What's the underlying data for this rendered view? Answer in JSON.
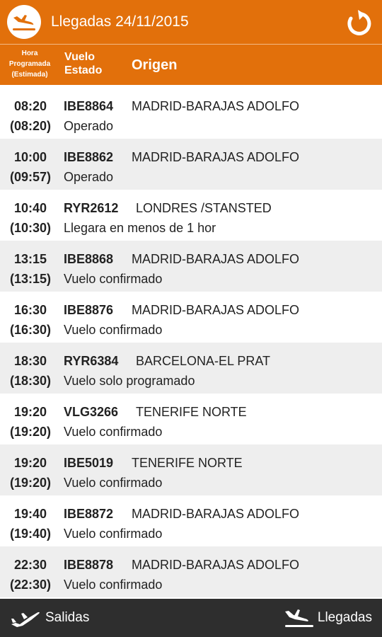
{
  "appbar": {
    "title": "Llegadas 24/11/2015",
    "logo_icon": "airplane-landing-icon",
    "refresh_icon": "refresh-icon"
  },
  "table_header": {
    "hora_line1": "Hora",
    "hora_line2": "Programada",
    "hora_line3": "(Estimada)",
    "vuelo_line1": "Vuelo",
    "vuelo_line2": "Estado",
    "origen": "Origen"
  },
  "flights": [
    {
      "scheduled": "08:20",
      "estimated": "(08:20)",
      "flight": "IBE8864",
      "origin": "MADRID-BARAJAS ADOLFO",
      "status": "Operado"
    },
    {
      "scheduled": "10:00",
      "estimated": "(09:57)",
      "flight": "IBE8862",
      "origin": "MADRID-BARAJAS ADOLFO",
      "status": "Operado"
    },
    {
      "scheduled": "10:40",
      "estimated": "(10:30)",
      "flight": "RYR2612",
      "origin": "LONDRES /STANSTED",
      "status": "Llegara en menos de 1 hor"
    },
    {
      "scheduled": "13:15",
      "estimated": "(13:15)",
      "flight": "IBE8868",
      "origin": "MADRID-BARAJAS ADOLFO",
      "status": "Vuelo confirmado"
    },
    {
      "scheduled": "16:30",
      "estimated": "(16:30)",
      "flight": "IBE8876",
      "origin": "MADRID-BARAJAS ADOLFO",
      "status": "Vuelo confirmado"
    },
    {
      "scheduled": "18:30",
      "estimated": "(18:30)",
      "flight": "RYR6384",
      "origin": "BARCELONA-EL PRAT",
      "status": "Vuelo solo programado"
    },
    {
      "scheduled": "19:20",
      "estimated": "(19:20)",
      "flight": "VLG3266",
      "origin": "TENERIFE NORTE",
      "status": "Vuelo confirmado"
    },
    {
      "scheduled": "19:20",
      "estimated": "(19:20)",
      "flight": "IBE5019",
      "origin": "TENERIFE NORTE",
      "status": "Vuelo confirmado"
    },
    {
      "scheduled": "19:40",
      "estimated": "(19:40)",
      "flight": "IBE8872",
      "origin": "MADRID-BARAJAS ADOLFO",
      "status": "Vuelo confirmado"
    },
    {
      "scheduled": "22:30",
      "estimated": "(22:30)",
      "flight": "IBE8878",
      "origin": "MADRID-BARAJAS ADOLFO",
      "status": "Vuelo confirmado"
    }
  ],
  "bottom_nav": {
    "salidas_label": "Salidas",
    "salidas_icon": "airplane-takeoff-icon",
    "llegadas_label": "Llegadas",
    "llegadas_icon": "airplane-landing-icon"
  },
  "colors": {
    "accent": "#e2700b",
    "row_alt": "#eeeeee",
    "bottom_bar": "#2e2e2e"
  }
}
